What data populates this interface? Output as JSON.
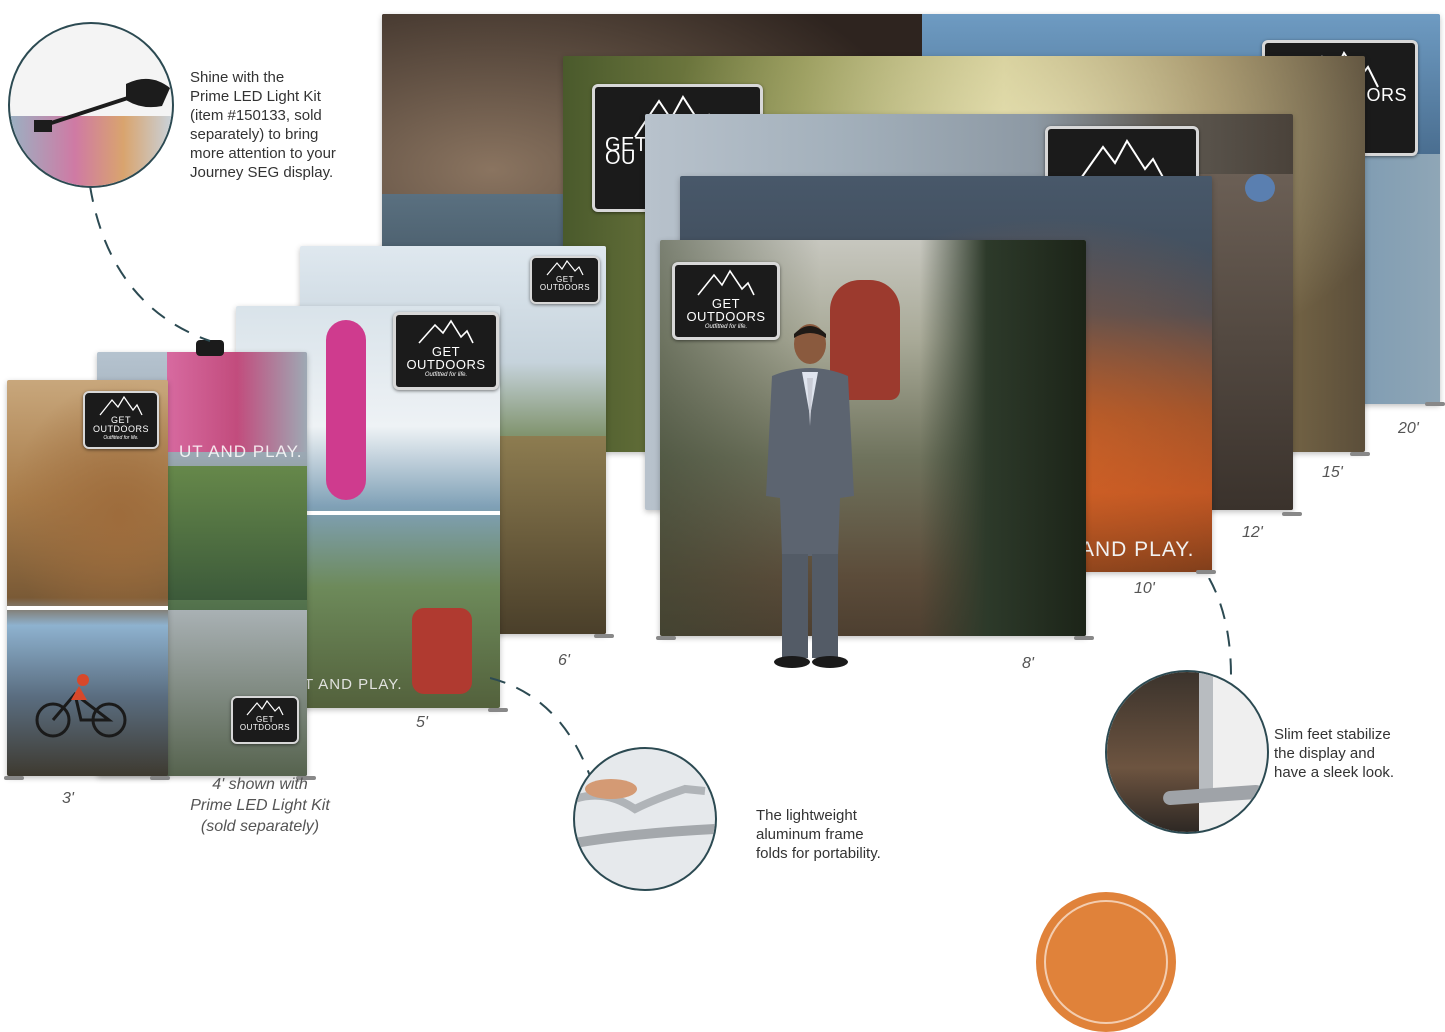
{
  "displays": {
    "d3": {
      "label": "3'"
    },
    "d4": {
      "label_lines": [
        "4' shown with",
        "Prime LED Light Kit",
        "(sold separately)"
      ]
    },
    "d5": {
      "label": "5'"
    },
    "d6": {
      "label": "6'"
    },
    "d8": {
      "label": "8'"
    },
    "d10": {
      "label": "10'"
    },
    "d12": {
      "label": "12'"
    },
    "d15": {
      "label": "15'"
    },
    "d20": {
      "label": "20'"
    }
  },
  "logo": {
    "line1": "GET",
    "line2": "OUTDOORS",
    "tagline": "Outfitted for life.",
    "partial_line1": "GET",
    "partial_line2": "OU",
    "partial_right": "ORS"
  },
  "graphic_text": {
    "play_banner": "AND PLAY.",
    "play_banner_5": "T AND PLAY.",
    "play_banner_4": "UT AND PLAY."
  },
  "callouts": {
    "light_kit": [
      "Shine with the",
      "Prime LED Light Kit",
      "(item #150133, sold",
      "separately) to bring",
      "more attention to your",
      "Journey SEG display."
    ],
    "frame": [
      "The lightweight",
      "aluminum frame",
      "folds for portability."
    ],
    "feet": [
      "Slim feet stabilize",
      "the display and",
      "have a sleek look."
    ]
  },
  "colors": {
    "circle_border": "#2c4a52",
    "badge_orange": "#e0823a"
  }
}
